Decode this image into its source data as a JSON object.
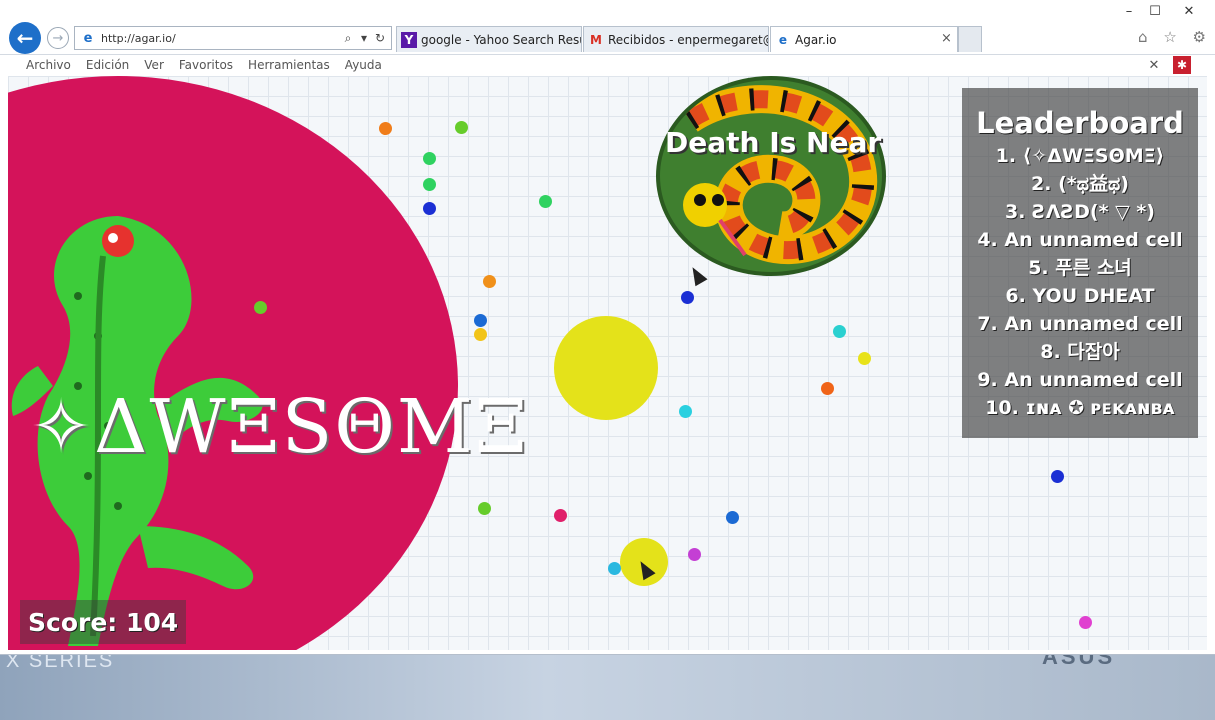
{
  "browser": {
    "url": "http://agar.io/",
    "tabs": [
      {
        "favicon": "Y",
        "label": "google - Yahoo Search Results"
      },
      {
        "favicon": "M",
        "label": "Recibidos - enpermegaret@g..."
      },
      {
        "favicon": "e",
        "label": "Agar.io"
      }
    ],
    "tab_close": "×",
    "menu": [
      "Archivo",
      "Edición",
      "Ver",
      "Favoritos",
      "Herramientas",
      "Ayuda"
    ],
    "window_controls": {
      "minimize": "–",
      "maximize": "☐",
      "close": "✕"
    },
    "icons": [
      "back-arrow-icon",
      "forward-arrow-icon",
      "ie-logo-icon",
      "search-icon",
      "refresh-icon",
      "home-icon",
      "favorites-star-icon",
      "settings-gear-icon"
    ]
  },
  "game": {
    "player_name": "✧ΔWΞSΘMΞ",
    "enemy_name": "Death Is Near",
    "score_label": "Score: 104",
    "leaderboard": {
      "title": "Leaderboard",
      "rows": [
        "1. ⟨✧ΔWΞSΘMΞ⟩",
        "2. (*ಥ益ಥ)",
        "3. ƧɅƧD(* ▽ *)",
        "4. An unnamed cell",
        "5. 푸른 소녀",
        "6. YOU DHEAT",
        "7. An unnamed cell",
        "8. 다잡아",
        "9. An unnamed cell",
        "10. ɪɴᴀ ✪ ᴘᴇᴋᴀɴʙᴀ"
      ]
    },
    "colors": {
      "player_cell": "#d4135a",
      "gecko": "#3dcc3a",
      "yellow_cell": "#e4e21a",
      "snake_cell": "#3f7f2f"
    }
  },
  "desktop": {
    "brand_left": "X SERIES",
    "brand_right": "ASUS"
  }
}
